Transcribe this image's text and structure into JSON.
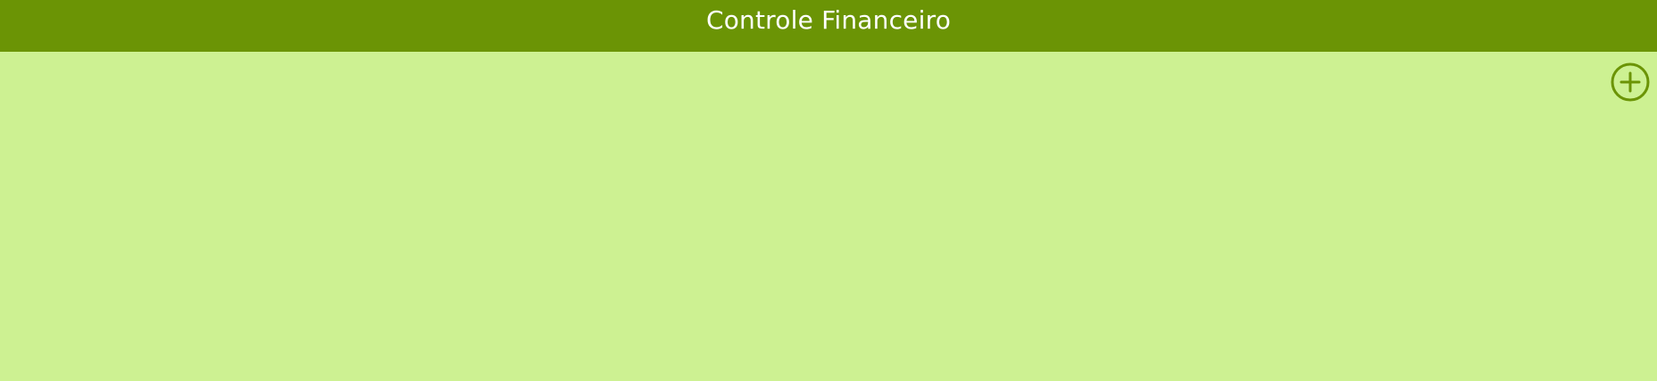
{
  "header": {
    "title": "Controle Financeiro"
  },
  "actions": {
    "add_icon": "plus-circle-icon"
  },
  "colors": {
    "header_background": "#6b9405",
    "content_background": "#cdf192",
    "accent": "#6b9405",
    "header_text": "#ffffff"
  }
}
